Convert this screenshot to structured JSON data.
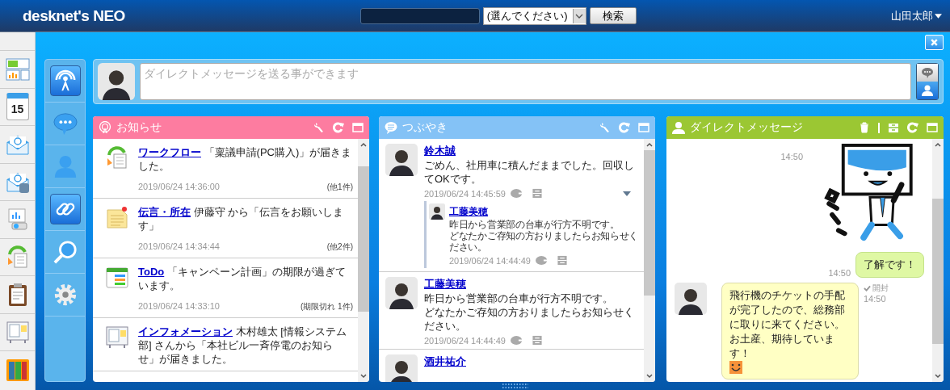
{
  "header": {
    "logo": "desknet's NEO",
    "select": "(選んでください)",
    "search_button": "検索",
    "user": "山田太郎"
  },
  "app_icons": [
    {
      "kind": "portal"
    },
    {
      "kind": "calendar",
      "label": "15"
    },
    {
      "kind": "mail"
    },
    {
      "kind": "mail-storage"
    },
    {
      "kind": "presentation"
    },
    {
      "kind": "workflow"
    },
    {
      "kind": "clipboard"
    },
    {
      "kind": "bulletin"
    },
    {
      "kind": "binders"
    }
  ],
  "tools": [
    {
      "kind": "broadcast",
      "selected": true
    },
    {
      "kind": "chat",
      "selected": false
    },
    {
      "kind": "person",
      "selected": false
    },
    {
      "kind": "link",
      "selected": true
    },
    {
      "kind": "search",
      "selected": false
    },
    {
      "kind": "settings",
      "selected": false
    }
  ],
  "message_bar": {
    "placeholder": "ダイレクトメッセージを送る事ができます"
  },
  "notices": {
    "title": "お知らせ",
    "items": [
      {
        "kind": "workflow",
        "link": "ワークフロー",
        "text": " 「稟議申請(PC購入)」が届きました。",
        "time": "2019/06/24 14:36:00",
        "count": "(他1件)"
      },
      {
        "kind": "memo",
        "link": "伝言・所在",
        "text": " 伊藤守 から「伝言をお願いします」",
        "time": "2019/06/24 14:34:44",
        "count": "(他2件)"
      },
      {
        "kind": "todo",
        "link": "ToDo",
        "text": " 「キャンペーン計画」の期限が過ぎています。",
        "time": "2019/06/24 14:33:10",
        "count": "(期限切れ 1件)"
      },
      {
        "kind": "information",
        "link": "インフォメーション",
        "text": " 木村雄太 [情報システム部] さんから「本社ビル一斉停電のお知らせ」が届きました。"
      }
    ]
  },
  "tweets": {
    "title": "つぶやき",
    "posts": [
      {
        "name": "鈴木誠",
        "text": [
          "ごめん、社用車に積んだままでした。回収してOKです。"
        ],
        "time": "2019/06/24 14:45:59",
        "expandable": true,
        "replies": [
          {
            "name": "工藤美穂",
            "text": [
              "昨日から営業部の台車が行方不明です。",
              "どなたかご存知の方おりましたらお知らせください。"
            ],
            "time": "2019/06/24 14:44:49"
          }
        ]
      },
      {
        "name": "工藤美穂",
        "text": [
          "昨日から営業部の台車が行方不明です。",
          "どなたかご存知の方おりましたらお知らせください。"
        ],
        "time": "2019/06/24 14:44:49",
        "expandable": false
      },
      {
        "name": "酒井祐介"
      }
    ]
  },
  "direct": {
    "title": "ダイレクトメッセージ",
    "messages": [
      {
        "kind": "sticker",
        "time": "14:50"
      },
      {
        "kind": "sent",
        "text": "了解です！",
        "time": "14:50"
      },
      {
        "kind": "received",
        "text": "飛行機のチケットの手配が完了したので、総務部に取りに来てください。お土産、期待しています！",
        "emoji": true,
        "status": "開封",
        "time": "14:50"
      }
    ]
  }
}
